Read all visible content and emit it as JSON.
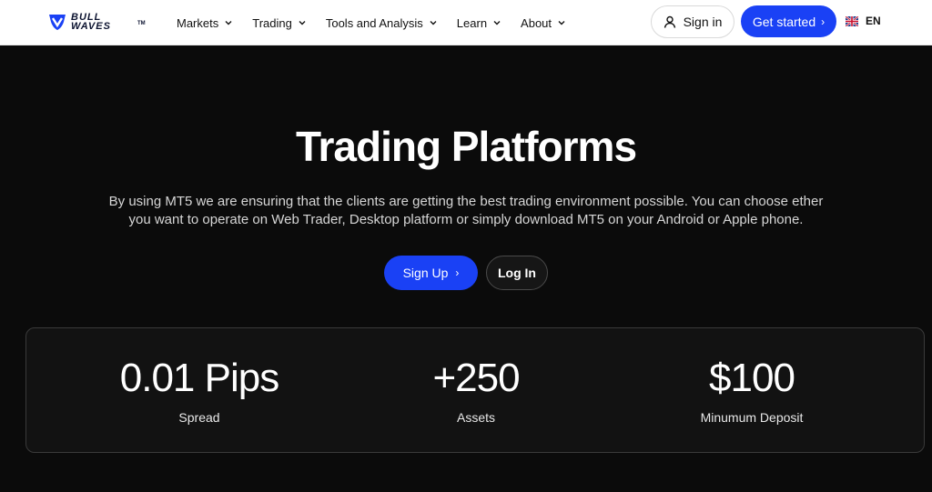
{
  "brand": {
    "line1": "BULL",
    "line2": "WAVES",
    "tm": "TM",
    "accent": "#1a41f5"
  },
  "nav": {
    "items": [
      {
        "label": "Markets"
      },
      {
        "label": "Trading"
      },
      {
        "label": "Tools and Analysis"
      },
      {
        "label": "Learn"
      },
      {
        "label": "About"
      }
    ]
  },
  "header_actions": {
    "signin_label": "Sign in",
    "signin_icon": "user-icon",
    "get_started_label": "Get started",
    "lang_label": "EN",
    "lang_icon": "uk-flag-icon"
  },
  "hero": {
    "title": "Trading Platforms",
    "description": "By using MT5 we are ensuring that the clients are getting the best trading environment possible. You can choose ether you want to operate on Web Trader, Desktop platform or simply download MT5 on your Android or Apple phone.",
    "signup_label": "Sign Up",
    "login_label": "Log In"
  },
  "stats": [
    {
      "value": "0.01 Pips",
      "label": "Spread"
    },
    {
      "value": "+250",
      "label": "Assets"
    },
    {
      "value": "$100",
      "label": "Minumum Deposit"
    }
  ]
}
